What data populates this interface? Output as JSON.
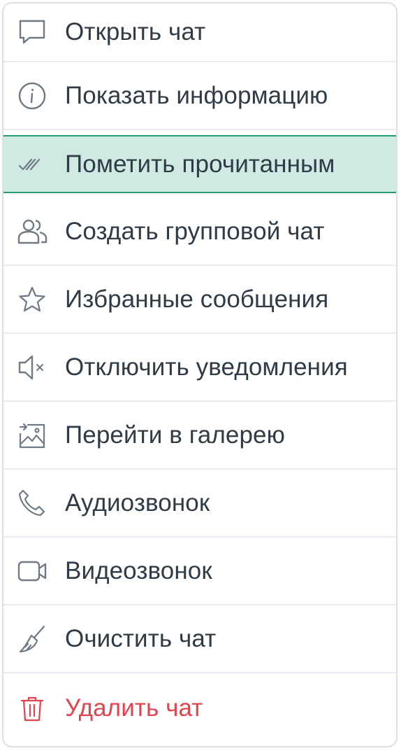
{
  "colors": {
    "text": "#2f3b46",
    "icon": "#6f7a85",
    "danger": "#e2434d",
    "active_bg": "#cfeae2",
    "active_border": "#2a9a72"
  },
  "menu": {
    "items": [
      {
        "label": "Открыть чат",
        "icon": "chat-bubble-icon"
      },
      {
        "label": "Показать информацию",
        "icon": "info-icon"
      },
      {
        "label": "Пометить прочитанным",
        "icon": "double-check-icon",
        "state": "highlighted"
      },
      {
        "label": "Создать групповой чат",
        "icon": "users-icon"
      },
      {
        "label": "Избранные сообщения",
        "icon": "star-icon"
      },
      {
        "label": "Отключить уведомления",
        "icon": "speaker-mute-icon"
      },
      {
        "label": "Перейти в галерею",
        "icon": "gallery-icon"
      },
      {
        "label": "Аудиозвонок",
        "icon": "phone-icon"
      },
      {
        "label": "Видеозвонок",
        "icon": "video-camera-icon"
      },
      {
        "label": "Очистить чат",
        "icon": "broom-icon"
      },
      {
        "label": "Удалить чат",
        "icon": "trash-icon",
        "state": "danger"
      }
    ]
  }
}
